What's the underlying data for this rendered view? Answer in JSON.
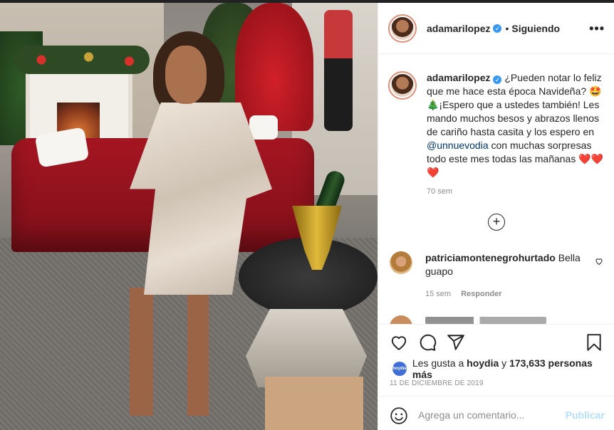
{
  "header": {
    "username": "adamarilopez",
    "separator": "•",
    "follow_status": "Siguiendo",
    "more_label": "•••"
  },
  "caption": {
    "username": "adamarilopez",
    "text_before_mention": "¿Pueden notar lo feliz que me hace esta época Navideña? 🤩🎄¡Espero que a ustedes también! Les mando muchos besos y abrazos llenos de cariño hasta casita y los espero en ",
    "mention": "@unnuevodia",
    "text_after_mention": " con muchas sorpresas todo este mes todas las mañanas ❤️❤️❤️",
    "time": "70 sem"
  },
  "load_more_label": "+",
  "comment": {
    "username": "patriciamontenegrohurtado",
    "text": "Bella guapo",
    "time": "15 sem",
    "reply_label": "Responder"
  },
  "likes": {
    "avatar_label": "hoydia",
    "prefix": "Les gusta a ",
    "user": "hoydia",
    "middle": " y ",
    "count": "173,633 personas más"
  },
  "date": "11 DE DICIEMBRE DE 2019",
  "add_comment": {
    "placeholder": "Agrega un comentario...",
    "publish_label": "Publicar"
  },
  "icons": {
    "like": "heart-icon",
    "comment": "comment-icon",
    "share": "share-icon",
    "save": "bookmark-icon",
    "emoji": "emoji-icon",
    "verified": "verified-badge-icon"
  },
  "colors": {
    "accent_link": "#00376b",
    "verified": "#3897f0",
    "publish_disabled": "#b2dffc",
    "meta_gray": "#8e8e8e"
  }
}
